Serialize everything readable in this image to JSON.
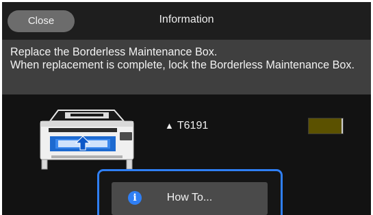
{
  "header": {
    "close_label": "Close",
    "title": "Information"
  },
  "message": {
    "text": "Replace the Borderless Maintenance Box.\nWhen replacement is complete, lock the Borderless Maintenance Box."
  },
  "part": {
    "icon": "ink-drop-icon",
    "number": "T6191",
    "level_color": "#5b5100"
  },
  "actions": {
    "howto_label": "How To...",
    "howto_icon": "info-icon",
    "focus_color": "#2f7ff5"
  }
}
